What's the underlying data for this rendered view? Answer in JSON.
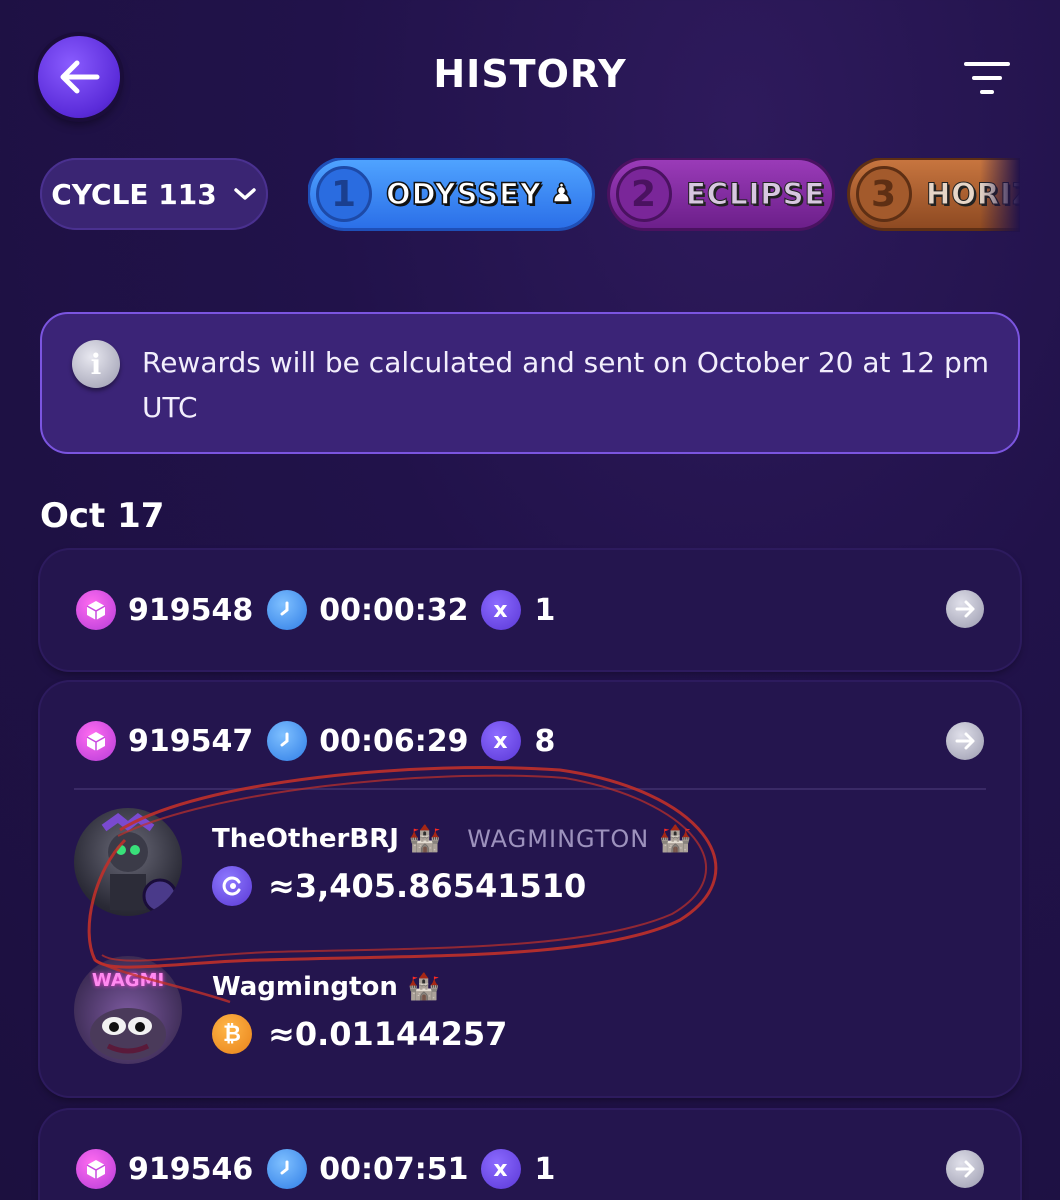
{
  "header": {
    "title": "HISTORY"
  },
  "cycle": {
    "label": "CYCLE 113"
  },
  "tabs": [
    {
      "num": "1",
      "label": "ODYSSEY",
      "extra": "♟"
    },
    {
      "num": "2",
      "label": "ECLIPSE"
    },
    {
      "num": "3",
      "label": "HORIZ"
    }
  ],
  "info": {
    "text": "Rewards will be calculated and sent on October 20 at 12 pm UTC"
  },
  "date_heading": "Oct 17",
  "rounds": [
    {
      "block": "919548",
      "duration": "00:00:32",
      "multiplier": "1"
    },
    {
      "block": "919547",
      "duration": "00:06:29",
      "multiplier": "8",
      "winners": [
        {
          "name": "TheOtherBRJ",
          "team": "WAGMINGTON",
          "amount": "≈3,405.86541510",
          "coin": "purple-token"
        },
        {
          "name": "Wagmington",
          "avatar_text": "WAGMI",
          "amount": "≈0.01144257",
          "coin": "bitcoin"
        }
      ]
    },
    {
      "block": "919546",
      "duration": "00:07:51",
      "multiplier": "1"
    }
  ],
  "colors": {
    "accent": "#5a2bd9",
    "card": "#24154e",
    "annotation": "#c0302a"
  }
}
